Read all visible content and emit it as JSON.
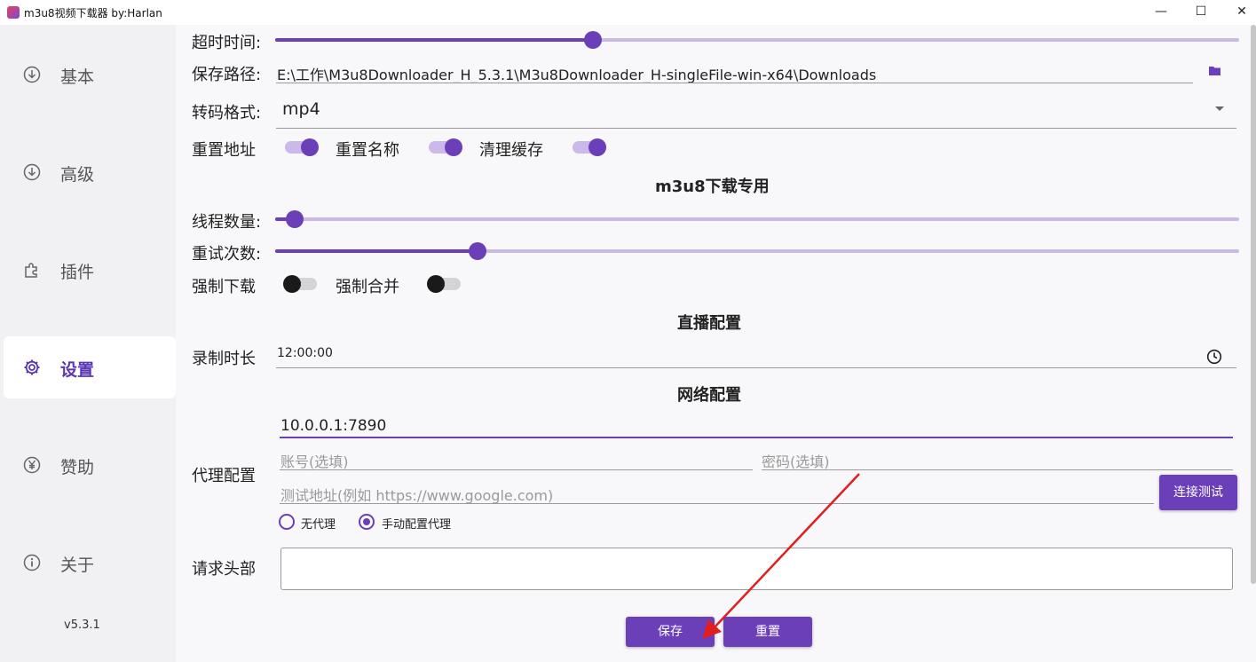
{
  "window": {
    "title": "m3u8视频下载器 by:Harlan",
    "minimize": "—",
    "maximize": "☐",
    "close": "✕"
  },
  "sidebar": {
    "items": [
      {
        "label": "基本",
        "icon": "download-circle-icon",
        "active": false
      },
      {
        "label": "高级",
        "icon": "download-circle-icon",
        "active": false
      },
      {
        "label": "插件",
        "icon": "puzzle-icon",
        "active": false
      },
      {
        "label": "设置",
        "icon": "gear-icon",
        "active": true
      },
      {
        "label": "赞助",
        "icon": "yen-coin-icon",
        "active": false
      },
      {
        "label": "关于",
        "icon": "info-icon",
        "active": false
      }
    ],
    "version": "v5.3.1"
  },
  "settings": {
    "timeout_label": "超时时间:",
    "timeout_level": 0.33,
    "save_path_label": "保存路径:",
    "save_path_value": "E:\\工作\\M3u8Downloader_H_5.3.1\\M3u8Downloader_H-singleFile-win-x64\\Downloads",
    "format_label": "转码格式:",
    "format_value": "mp4",
    "reset_url_label": "重置地址",
    "reset_name_label": "重置名称",
    "clear_cache_label": "清理缓存"
  },
  "m3u8": {
    "section_title": "m3u8下载专用",
    "threads_label": "线程数量:",
    "threads_level": 0.02,
    "retry_label": "重试次数:",
    "retry_level": 0.21,
    "force_download_label": "强制下载",
    "force_merge_label": "强制合并"
  },
  "live": {
    "section_title": "直播配置",
    "duration_label": "录制时长",
    "duration_value": "12:00:00"
  },
  "network": {
    "section_title": "网络配置",
    "proxy_label": "代理配置",
    "proxy_value": "10.0.0.1:7890",
    "account_placeholder": "账号(选填)",
    "password_placeholder": "密码(选填)",
    "test_url_placeholder": "测试地址(例如 https://www.google.com)",
    "test_button": "连接测试",
    "radio_no_proxy": "无代理",
    "radio_manual": "手动配置代理",
    "headers_label": "请求头部"
  },
  "actions": {
    "save": "保存",
    "reset": "重置"
  },
  "colors": {
    "accent": "#6b3fb8",
    "accent_light": "#c9b8e8",
    "annotation_arrow": "#e02020"
  }
}
